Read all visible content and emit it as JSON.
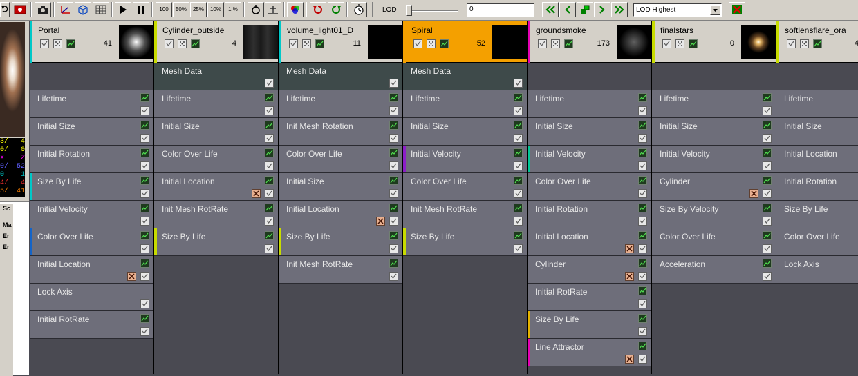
{
  "toolbar": {
    "zoom_buttons": [
      "100",
      "50%",
      "25%",
      "10%",
      "1 %"
    ],
    "lod_label": "LOD",
    "lod_value": "0",
    "lod_level": "LOD Highest"
  },
  "preview": {
    "stats": [
      {
        "left": "3/",
        "right": "4",
        "color": "#ffff00"
      },
      {
        "left": "0/",
        "right": "0",
        "color": "#ffff00"
      },
      {
        "left": "X",
        "right": "Z",
        "color": "#ff00ff"
      },
      {
        "left": "0/",
        "right": "52",
        "color": "#6060ff"
      },
      {
        "left": "0",
        "right": "1",
        "color": "#00c0c0"
      },
      {
        "left": "4/",
        "right": "4",
        "color": "#ff3030"
      },
      {
        "left": "5/",
        "right": "41",
        "color": "#ff8000"
      }
    ],
    "prop_labels": [
      "Sc",
      "Ma",
      "Er",
      "Er"
    ]
  },
  "colors": {
    "panel": "#d4d0c8",
    "module_bg": "#6e6e7a",
    "selected": "#f4a000",
    "cyan": "#00c8c8",
    "yellow_green": "#c8dc00",
    "purple": "#8c1ec8",
    "teal": "#00c896",
    "blue": "#1464c8",
    "gold": "#e6b400",
    "magenta": "#e600b4"
  },
  "emitters": [
    {
      "name": "Portal",
      "count": "41",
      "stripe": "#00c8c8",
      "thumb": "radial-gradient(circle at 50% 50%, #ffffff 0%, #c8c8c8 10%, #505050 35%, #000 65%)",
      "modules": [
        {
          "label": "",
          "type": "blank"
        },
        {
          "label": "Lifetime"
        },
        {
          "label": "Initial Size"
        },
        {
          "label": "Initial Rotation"
        },
        {
          "label": "Size By Life",
          "stripe": "#00c8c8"
        },
        {
          "label": "Initial Velocity"
        },
        {
          "label": "Color Over Life",
          "stripe": "#1464c8"
        },
        {
          "label": "Initial Location",
          "x": true
        },
        {
          "label": "Lock Axis",
          "nograph": true
        },
        {
          "label": "Initial RotRate"
        }
      ]
    },
    {
      "name": "Cylinder_outside",
      "count": "4",
      "stripe": "#c8dc00",
      "thumb": "linear-gradient(90deg,#101010 0%,#303030 30%,#1a1a1a 50%,#303030 70%,#101010 100%)",
      "modules": [
        {
          "label": "Mesh Data",
          "type": "mesh"
        },
        {
          "label": "Lifetime"
        },
        {
          "label": "Initial Size"
        },
        {
          "label": "Color Over Life"
        },
        {
          "label": "Initial Location",
          "x": true
        },
        {
          "label": "Init Mesh RotRate"
        },
        {
          "label": "Size By Life",
          "stripe": "#c8dc00"
        }
      ]
    },
    {
      "name": "volume_light01_D",
      "count": "11",
      "stripe": "#00c8c8",
      "thumb": "#000",
      "modules": [
        {
          "label": "Mesh Data",
          "type": "mesh"
        },
        {
          "label": "Lifetime"
        },
        {
          "label": "Init Mesh Rotation"
        },
        {
          "label": "Color Over Life"
        },
        {
          "label": "Initial Size"
        },
        {
          "label": "Initial Location",
          "x": true
        },
        {
          "label": "Size By Life",
          "stripe": "#c8dc00"
        },
        {
          "label": "Init Mesh RotRate"
        }
      ]
    },
    {
      "name": "Spiral",
      "count": "52",
      "stripe": "#f4a000",
      "selected": true,
      "thumb": "#000",
      "modules": [
        {
          "label": "Mesh Data",
          "type": "mesh"
        },
        {
          "label": "Lifetime"
        },
        {
          "label": "Initial Size"
        },
        {
          "label": "Initial Velocity",
          "stripe": "#8c1ec8"
        },
        {
          "label": "Color Over Life"
        },
        {
          "label": "Init Mesh RotRate"
        },
        {
          "label": "Size By Life",
          "stripe": "#c8dc00"
        }
      ]
    },
    {
      "name": "groundsmoke",
      "count": "173",
      "stripe": "#e600b4",
      "thumb": "radial-gradient(circle at 50% 50%, #606060 0%, #303030 30%, #000 60%)",
      "modules": [
        {
          "label": "",
          "type": "blank"
        },
        {
          "label": "Lifetime"
        },
        {
          "label": "Initial Size"
        },
        {
          "label": "Initial Velocity",
          "stripe": "#00c896"
        },
        {
          "label": "Color Over Life"
        },
        {
          "label": "Initial Rotation"
        },
        {
          "label": "Initial Location",
          "x": true
        },
        {
          "label": "Cylinder",
          "x": true
        },
        {
          "label": "Initial RotRate"
        },
        {
          "label": "Size By Life",
          "stripe": "#e6b400"
        },
        {
          "label": "Line Attractor",
          "stripe": "#e600b4",
          "x": true
        }
      ]
    },
    {
      "name": "finalstars",
      "count": "0",
      "stripe": "#c8dc00",
      "thumb": "radial-gradient(circle at 50% 50%, #fff8e0 0%, #e0b060 10%, #604020 25%, #000 45%)",
      "modules": [
        {
          "label": "",
          "type": "blank"
        },
        {
          "label": "Lifetime"
        },
        {
          "label": "Initial Size"
        },
        {
          "label": "Initial Velocity"
        },
        {
          "label": "Cylinder",
          "x": true
        },
        {
          "label": "Size By Velocity"
        },
        {
          "label": "Color Over Life"
        },
        {
          "label": "Acceleration"
        }
      ]
    },
    {
      "name": "softlensflare_ora",
      "count": "4",
      "stripe": "#c8dc00",
      "thumb": "#000",
      "modules": [
        {
          "label": "",
          "type": "blank"
        },
        {
          "label": "Lifetime"
        },
        {
          "label": "Initial Size"
        },
        {
          "label": "Initial Location"
        },
        {
          "label": "Initial Rotation"
        },
        {
          "label": "Size By Life"
        },
        {
          "label": "Color Over Life"
        },
        {
          "label": "Lock Axis"
        }
      ]
    }
  ]
}
